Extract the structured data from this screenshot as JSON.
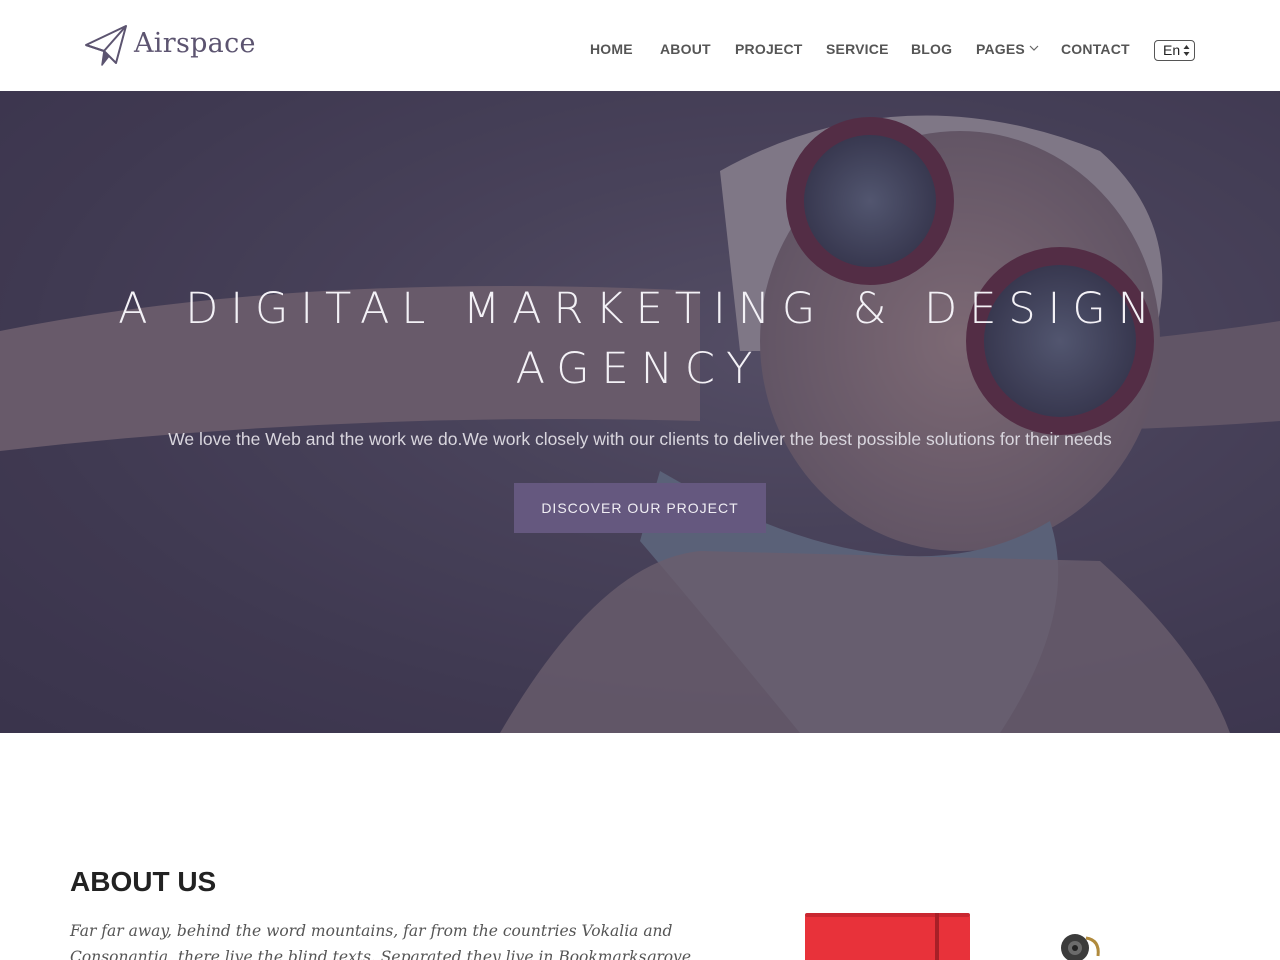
{
  "header": {
    "logo_text": "Airspace",
    "nav": [
      {
        "label": "HOME"
      },
      {
        "label": "ABOUT"
      },
      {
        "label": "PROJECT"
      },
      {
        "label": "SERVICE"
      },
      {
        "label": "BLOG"
      },
      {
        "label": "PAGES"
      },
      {
        "label": "CONTACT"
      }
    ],
    "language": "En"
  },
  "hero": {
    "title_line1": "A DIGITAL MARKETING & DESIGN",
    "title_line2": "AGENCY",
    "subtitle": "We love the Web and the work we do.We work closely with our clients to deliver the best possible solutions for their needs",
    "button_label": "DISCOVER OUR PROJECT"
  },
  "about": {
    "title": "ABOUT US",
    "text": "Far far away, behind the word mountains, far from the countries Vokalia and Consonantia, there live the blind texts. Separated they live in Bookmarksgrove right at the coast of the"
  },
  "colors": {
    "accent": "#65587f",
    "logo": "#5c5470",
    "nav_text": "#555555"
  }
}
